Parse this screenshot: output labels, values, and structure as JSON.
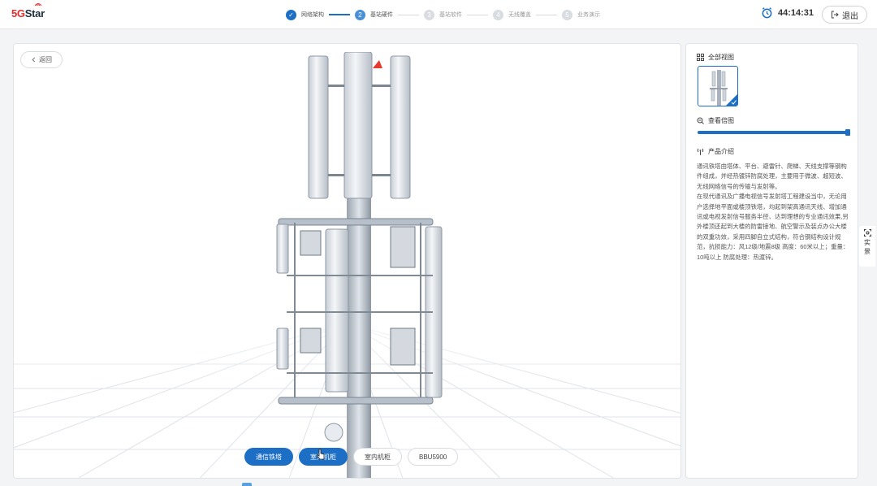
{
  "app": {
    "logo_text": "5GStar",
    "logo_accent": "5G"
  },
  "steps": [
    {
      "number": "✓",
      "label": "网络架构",
      "state": "done"
    },
    {
      "number": "2",
      "label": "基站硬件",
      "state": "active"
    },
    {
      "number": "3",
      "label": "基站软件",
      "state": "todo"
    },
    {
      "number": "4",
      "label": "无线覆盖",
      "state": "todo"
    },
    {
      "number": "5",
      "label": "业务演示",
      "state": "todo"
    }
  ],
  "header": {
    "timer": "44:14:31",
    "exit_label": "退出"
  },
  "viewer": {
    "back_label": "返回",
    "buttons": [
      {
        "label": "通信铁塔",
        "selected": true
      },
      {
        "label": "室外机柜",
        "selected": true
      },
      {
        "label": "室内机柜",
        "selected": false
      },
      {
        "label": "BBU5900",
        "selected": false
      }
    ]
  },
  "panel": {
    "all_views_title": "全部视图",
    "zoom_title": "查看倍图",
    "zoom_level": 1.0,
    "intro_title": "产品介绍",
    "intro_paragraphs": [
      "通讯铁塔由塔体、平台、避雷针、爬梯、天线支撑等钢构件组成，并经热镀锌防腐处理，主要用于微波、超短波、无线网络信号的传输与发射等。",
      "在现代通讯及广播电视信号发射塔工程建设当中，无论用户选择地平面或楼顶铁塔，均起到架高通讯天线、增加通讯或电视发射信号服务半径、达到理想的专业通讯效果,另外楼顶还起到大楼的防雷接地、航空警示及装点办公大楼的双重功效，采用四脚自立式结构，符合钢结构设计规范，抗损能力：风12级/地震8级 高度：60米以上；重量：10吨以上 防腐处理：热渡锌。"
    ]
  },
  "side_tab": {
    "label_1": "实",
    "label_2": "景"
  },
  "colors": {
    "accent": "#1c6fc4",
    "logo_red": "#e02c2c"
  }
}
